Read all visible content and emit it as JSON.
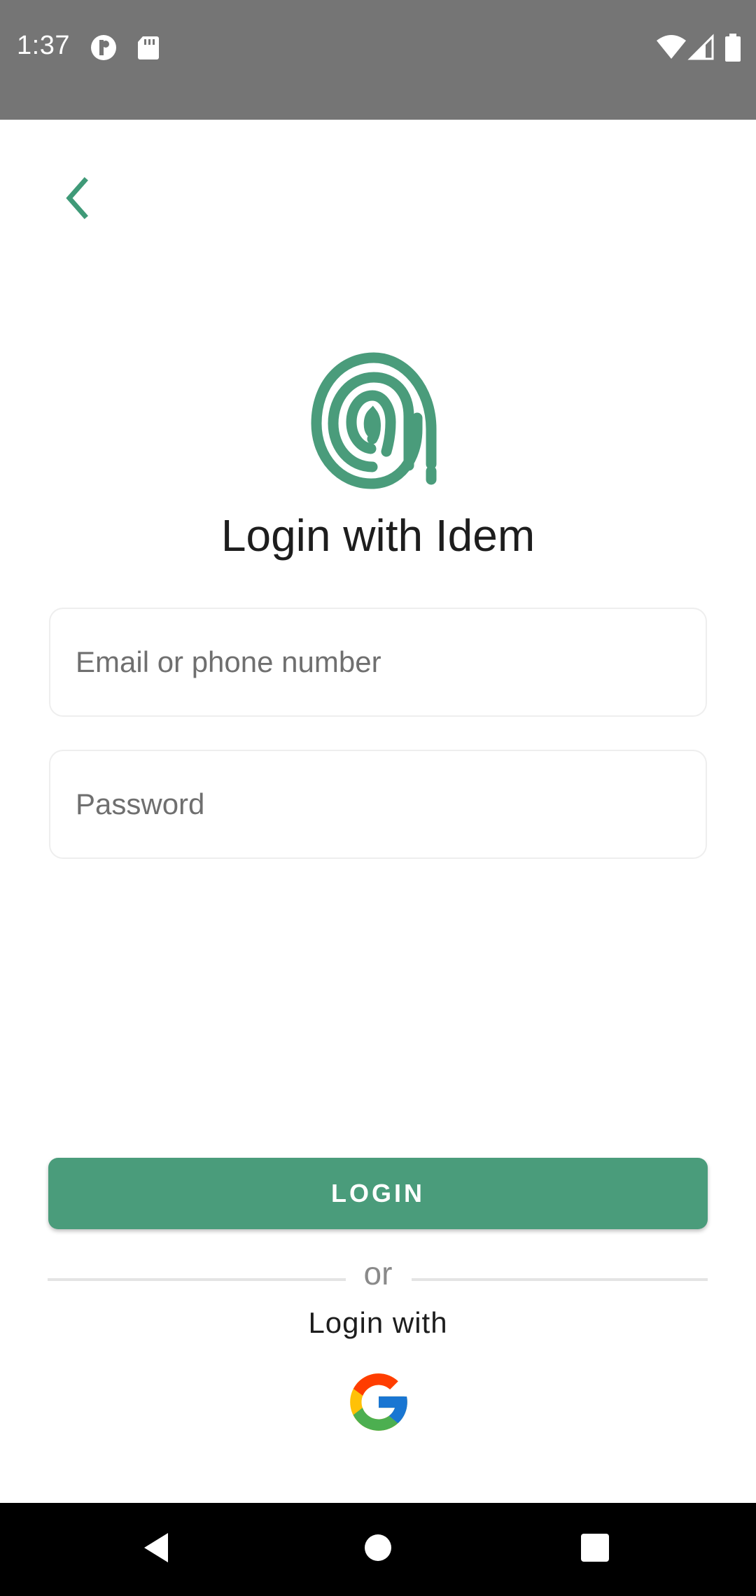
{
  "status_bar": {
    "time": "1:37",
    "icons": [
      "notification-icon",
      "sd-card-icon",
      "wifi-icon",
      "signal-icon",
      "battery-icon"
    ]
  },
  "header": {
    "back_icon": "chevron-left-icon"
  },
  "logo": {
    "icon": "fingerprint-icon"
  },
  "title": "Login with Idem",
  "form": {
    "email_placeholder": "Email or phone number",
    "email_value": "",
    "password_placeholder": "Password",
    "password_value": ""
  },
  "login_button_label": "LOGIN",
  "divider_text": "or",
  "alt_login_text": "Login with",
  "google_icon": "google-icon",
  "nav": {
    "back": "nav-back-icon",
    "home": "nav-home-icon",
    "recents": "nav-recents-icon"
  },
  "colors": {
    "accent": "#4a9c7b",
    "status_bar": "#757575",
    "nav_bar": "#000000"
  }
}
